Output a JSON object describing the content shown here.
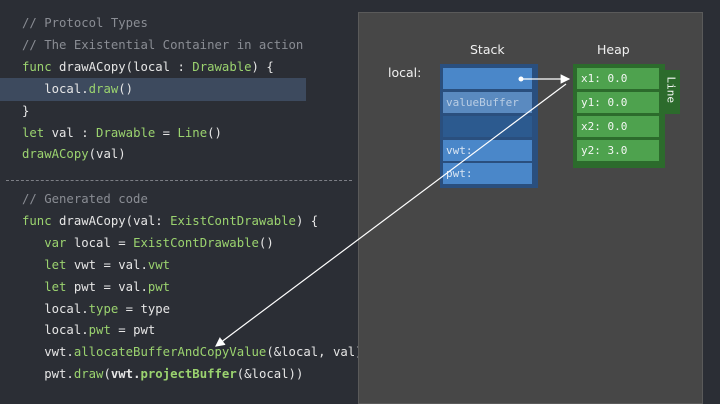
{
  "code_top": [
    {
      "parts": [
        {
          "t": "// Protocol Types",
          "c": "comment"
        }
      ]
    },
    {
      "parts": [
        {
          "t": "// The Existential Container in action",
          "c": "comment"
        }
      ]
    },
    {
      "parts": [
        {
          "t": "func ",
          "c": "kw"
        },
        {
          "t": "drawACopy(local : ",
          "c": "punct"
        },
        {
          "t": "Drawable",
          "c": "ty"
        },
        {
          "t": ") {",
          "c": "punct"
        }
      ]
    },
    {
      "parts": [
        {
          "t": "   local.",
          "c": "punct"
        },
        {
          "t": "draw",
          "c": "ty"
        },
        {
          "t": "()",
          "c": "punct"
        }
      ]
    },
    {
      "parts": [
        {
          "t": "}",
          "c": "punct"
        }
      ]
    },
    {
      "parts": [
        {
          "t": "let ",
          "c": "kw"
        },
        {
          "t": "val : ",
          "c": "punct"
        },
        {
          "t": "Drawable",
          "c": "ty"
        },
        {
          "t": " = ",
          "c": "punct"
        },
        {
          "t": "Line",
          "c": "ty"
        },
        {
          "t": "()",
          "c": "punct"
        }
      ]
    },
    {
      "parts": [
        {
          "t": "drawACopy",
          "c": "ty"
        },
        {
          "t": "(val)",
          "c": "punct"
        }
      ]
    }
  ],
  "code_bottom": [
    {
      "parts": [
        {
          "t": "// Generated code",
          "c": "comment"
        }
      ]
    },
    {
      "parts": [
        {
          "t": "func ",
          "c": "kw"
        },
        {
          "t": "drawACopy(val: ",
          "c": "punct"
        },
        {
          "t": "ExistContDrawable",
          "c": "ty"
        },
        {
          "t": ") {",
          "c": "punct"
        }
      ]
    },
    {
      "parts": [
        {
          "t": "   var ",
          "c": "kw"
        },
        {
          "t": "local = ",
          "c": "punct"
        },
        {
          "t": "ExistContDrawable",
          "c": "ty"
        },
        {
          "t": "()",
          "c": "punct"
        }
      ]
    },
    {
      "parts": [
        {
          "t": "   let ",
          "c": "kw"
        },
        {
          "t": "vwt = val.",
          "c": "punct"
        },
        {
          "t": "vwt",
          "c": "ty"
        }
      ]
    },
    {
      "parts": [
        {
          "t": "   let ",
          "c": "kw"
        },
        {
          "t": "pwt = val.",
          "c": "punct"
        },
        {
          "t": "pwt",
          "c": "ty"
        }
      ]
    },
    {
      "parts": [
        {
          "t": "   local.",
          "c": "punct"
        },
        {
          "t": "type",
          "c": "ty"
        },
        {
          "t": " = type",
          "c": "punct"
        }
      ]
    },
    {
      "parts": [
        {
          "t": "   local.",
          "c": "punct"
        },
        {
          "t": "pwt",
          "c": "ty"
        },
        {
          "t": " = pwt",
          "c": "punct"
        }
      ]
    },
    {
      "parts": [
        {
          "t": "   vwt.",
          "c": "punct"
        },
        {
          "t": "allocateBufferAndCopyValue",
          "c": "ty"
        },
        {
          "t": "(&local, val)",
          "c": "punct"
        }
      ]
    },
    {
      "parts": [
        {
          "t": "   pwt.",
          "c": "punct"
        },
        {
          "t": "draw",
          "c": "ty"
        },
        {
          "t": "(",
          "c": "punct"
        },
        {
          "t": "vwt.",
          "c": "punct bold"
        },
        {
          "t": "projectBuffer",
          "c": "ty bold"
        },
        {
          "t": "(&local))",
          "c": "punct"
        }
      ]
    }
  ],
  "diagram": {
    "stack_title": "Stack",
    "heap_title": "Heap",
    "local_label": "local:",
    "stack_cells": [
      "",
      "valueBuffer",
      "",
      "vwt:",
      "pwt:"
    ],
    "heap_cells": [
      "x1: 0.0",
      "y1: 0.0",
      "x2: 0.0",
      "y2: 3.0"
    ],
    "heap_type_label": "Line"
  },
  "colors": {
    "background": "#2b2e35",
    "keyword_green": "#9bd36f",
    "comment_gray": "#8a8d94",
    "stack_blue": "#4a87c9",
    "heap_green": "#4ea24e"
  }
}
